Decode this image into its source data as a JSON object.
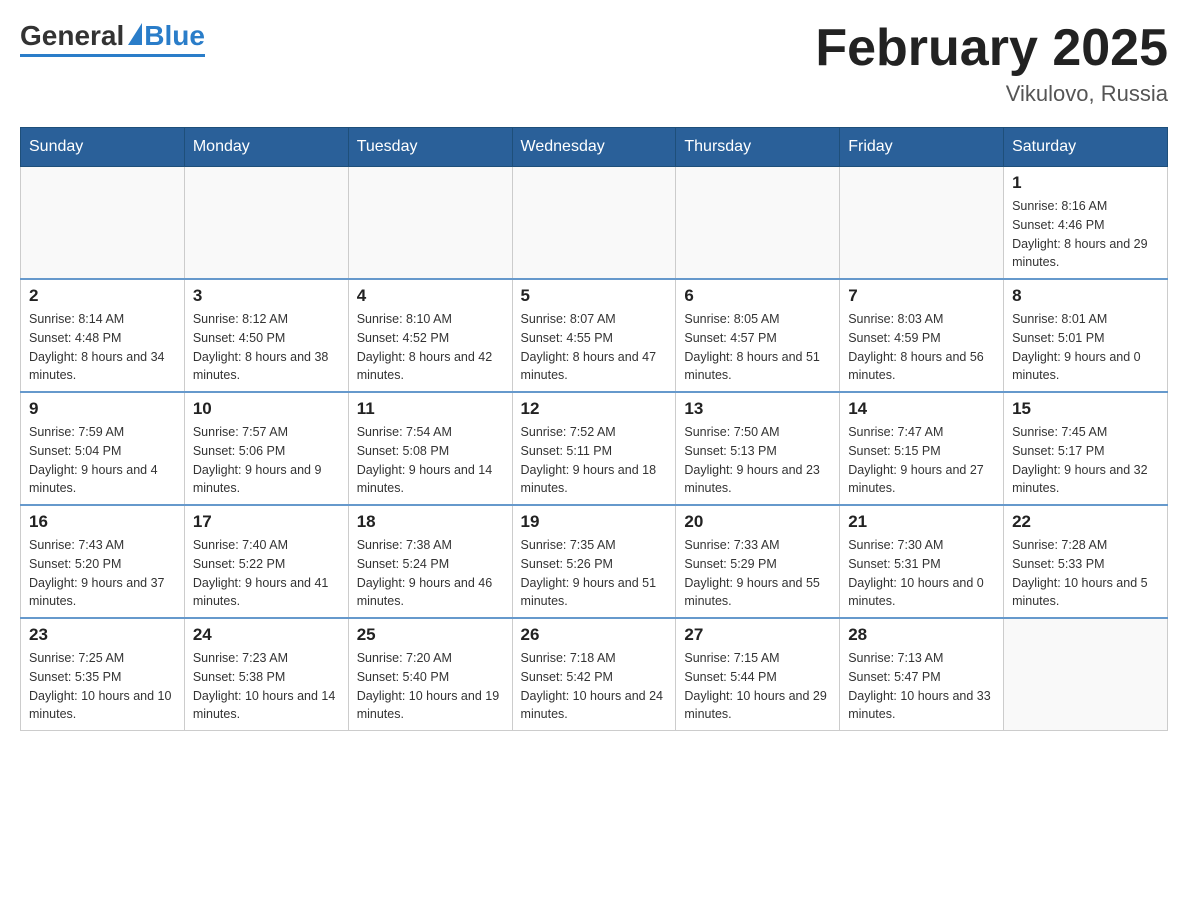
{
  "header": {
    "logo_general": "General",
    "logo_blue": "Blue",
    "month_title": "February 2025",
    "location": "Vikulovo, Russia"
  },
  "weekdays": [
    "Sunday",
    "Monday",
    "Tuesday",
    "Wednesday",
    "Thursday",
    "Friday",
    "Saturday"
  ],
  "weeks": [
    [
      {
        "day": "",
        "info": ""
      },
      {
        "day": "",
        "info": ""
      },
      {
        "day": "",
        "info": ""
      },
      {
        "day": "",
        "info": ""
      },
      {
        "day": "",
        "info": ""
      },
      {
        "day": "",
        "info": ""
      },
      {
        "day": "1",
        "info": "Sunrise: 8:16 AM\nSunset: 4:46 PM\nDaylight: 8 hours and 29 minutes."
      }
    ],
    [
      {
        "day": "2",
        "info": "Sunrise: 8:14 AM\nSunset: 4:48 PM\nDaylight: 8 hours and 34 minutes."
      },
      {
        "day": "3",
        "info": "Sunrise: 8:12 AM\nSunset: 4:50 PM\nDaylight: 8 hours and 38 minutes."
      },
      {
        "day": "4",
        "info": "Sunrise: 8:10 AM\nSunset: 4:52 PM\nDaylight: 8 hours and 42 minutes."
      },
      {
        "day": "5",
        "info": "Sunrise: 8:07 AM\nSunset: 4:55 PM\nDaylight: 8 hours and 47 minutes."
      },
      {
        "day": "6",
        "info": "Sunrise: 8:05 AM\nSunset: 4:57 PM\nDaylight: 8 hours and 51 minutes."
      },
      {
        "day": "7",
        "info": "Sunrise: 8:03 AM\nSunset: 4:59 PM\nDaylight: 8 hours and 56 minutes."
      },
      {
        "day": "8",
        "info": "Sunrise: 8:01 AM\nSunset: 5:01 PM\nDaylight: 9 hours and 0 minutes."
      }
    ],
    [
      {
        "day": "9",
        "info": "Sunrise: 7:59 AM\nSunset: 5:04 PM\nDaylight: 9 hours and 4 minutes."
      },
      {
        "day": "10",
        "info": "Sunrise: 7:57 AM\nSunset: 5:06 PM\nDaylight: 9 hours and 9 minutes."
      },
      {
        "day": "11",
        "info": "Sunrise: 7:54 AM\nSunset: 5:08 PM\nDaylight: 9 hours and 14 minutes."
      },
      {
        "day": "12",
        "info": "Sunrise: 7:52 AM\nSunset: 5:11 PM\nDaylight: 9 hours and 18 minutes."
      },
      {
        "day": "13",
        "info": "Sunrise: 7:50 AM\nSunset: 5:13 PM\nDaylight: 9 hours and 23 minutes."
      },
      {
        "day": "14",
        "info": "Sunrise: 7:47 AM\nSunset: 5:15 PM\nDaylight: 9 hours and 27 minutes."
      },
      {
        "day": "15",
        "info": "Sunrise: 7:45 AM\nSunset: 5:17 PM\nDaylight: 9 hours and 32 minutes."
      }
    ],
    [
      {
        "day": "16",
        "info": "Sunrise: 7:43 AM\nSunset: 5:20 PM\nDaylight: 9 hours and 37 minutes."
      },
      {
        "day": "17",
        "info": "Sunrise: 7:40 AM\nSunset: 5:22 PM\nDaylight: 9 hours and 41 minutes."
      },
      {
        "day": "18",
        "info": "Sunrise: 7:38 AM\nSunset: 5:24 PM\nDaylight: 9 hours and 46 minutes."
      },
      {
        "day": "19",
        "info": "Sunrise: 7:35 AM\nSunset: 5:26 PM\nDaylight: 9 hours and 51 minutes."
      },
      {
        "day": "20",
        "info": "Sunrise: 7:33 AM\nSunset: 5:29 PM\nDaylight: 9 hours and 55 minutes."
      },
      {
        "day": "21",
        "info": "Sunrise: 7:30 AM\nSunset: 5:31 PM\nDaylight: 10 hours and 0 minutes."
      },
      {
        "day": "22",
        "info": "Sunrise: 7:28 AM\nSunset: 5:33 PM\nDaylight: 10 hours and 5 minutes."
      }
    ],
    [
      {
        "day": "23",
        "info": "Sunrise: 7:25 AM\nSunset: 5:35 PM\nDaylight: 10 hours and 10 minutes."
      },
      {
        "day": "24",
        "info": "Sunrise: 7:23 AM\nSunset: 5:38 PM\nDaylight: 10 hours and 14 minutes."
      },
      {
        "day": "25",
        "info": "Sunrise: 7:20 AM\nSunset: 5:40 PM\nDaylight: 10 hours and 19 minutes."
      },
      {
        "day": "26",
        "info": "Sunrise: 7:18 AM\nSunset: 5:42 PM\nDaylight: 10 hours and 24 minutes."
      },
      {
        "day": "27",
        "info": "Sunrise: 7:15 AM\nSunset: 5:44 PM\nDaylight: 10 hours and 29 minutes."
      },
      {
        "day": "28",
        "info": "Sunrise: 7:13 AM\nSunset: 5:47 PM\nDaylight: 10 hours and 33 minutes."
      },
      {
        "day": "",
        "info": ""
      }
    ]
  ]
}
